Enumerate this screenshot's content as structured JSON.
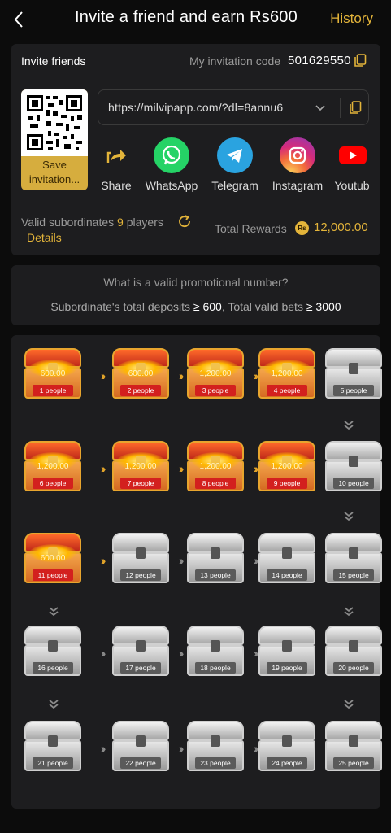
{
  "header": {
    "title": "Invite a friend and earn Rs600",
    "history_label": "History"
  },
  "invite": {
    "label": "Invite friends",
    "code_label": "My invitation code",
    "code": "501629550",
    "save_label": "Save invitation...",
    "url": "https://milvipapp.com/?dl=8annu6",
    "share_targets": [
      {
        "label": "Share",
        "icon": "share-icon"
      },
      {
        "label": "WhatsApp",
        "icon": "whatsapp-icon"
      },
      {
        "label": "Telegram",
        "icon": "telegram-icon"
      },
      {
        "label": "Instagram",
        "icon": "instagram-icon"
      },
      {
        "label": "Youtub",
        "icon": "youtube-icon"
      }
    ],
    "valid_label": "Valid subordinates",
    "valid_count": "9",
    "valid_unit": "players",
    "details_label": "Details",
    "total_rewards_label": "Total Rewards",
    "total_rewards_currency": "Rs",
    "total_rewards_value": "12,000.00"
  },
  "promo": {
    "question": "What is a valid promotional number?",
    "rule_prefix": "Subordinate's total deposits",
    "rule_deposit": "≥ 600",
    "rule_mid": ", Total valid bets",
    "rule_bets": "≥ 3000"
  },
  "chests": [
    {
      "label": "1 people",
      "amount": "600.00",
      "unlocked": true
    },
    {
      "label": "2 people",
      "amount": "600.00",
      "unlocked": true
    },
    {
      "label": "3 people",
      "amount": "1,200.00",
      "unlocked": true
    },
    {
      "label": "4 people",
      "amount": "1,200.00",
      "unlocked": true
    },
    {
      "label": "5 people",
      "amount": "",
      "unlocked": false
    },
    {
      "label": "6 people",
      "amount": "1,200.00",
      "unlocked": true
    },
    {
      "label": "7 people",
      "amount": "1,200.00",
      "unlocked": true
    },
    {
      "label": "8 people",
      "amount": "1,200.00",
      "unlocked": true
    },
    {
      "label": "9 people",
      "amount": "1,200.00",
      "unlocked": true
    },
    {
      "label": "10 people",
      "amount": "",
      "unlocked": false
    },
    {
      "label": "11 people",
      "amount": "600.00",
      "unlocked": true
    },
    {
      "label": "12 people",
      "amount": "",
      "unlocked": false
    },
    {
      "label": "13 people",
      "amount": "",
      "unlocked": false
    },
    {
      "label": "14 people",
      "amount": "",
      "unlocked": false
    },
    {
      "label": "15 people",
      "amount": "",
      "unlocked": false
    },
    {
      "label": "16 people",
      "amount": "",
      "unlocked": false
    },
    {
      "label": "17 people",
      "amount": "",
      "unlocked": false
    },
    {
      "label": "18 people",
      "amount": "",
      "unlocked": false
    },
    {
      "label": "19 people",
      "amount": "",
      "unlocked": false
    },
    {
      "label": "20 people",
      "amount": "",
      "unlocked": false
    },
    {
      "label": "21 people",
      "amount": "",
      "unlocked": false
    },
    {
      "label": "22 people",
      "amount": "",
      "unlocked": false
    },
    {
      "label": "23 people",
      "amount": "",
      "unlocked": false
    },
    {
      "label": "24 people",
      "amount": "",
      "unlocked": false
    },
    {
      "label": "25 people",
      "amount": "",
      "unlocked": false
    }
  ],
  "colors": {
    "accent": "#e3b43a",
    "background": "#0c0c0c",
    "card": "#1d1d1f"
  }
}
